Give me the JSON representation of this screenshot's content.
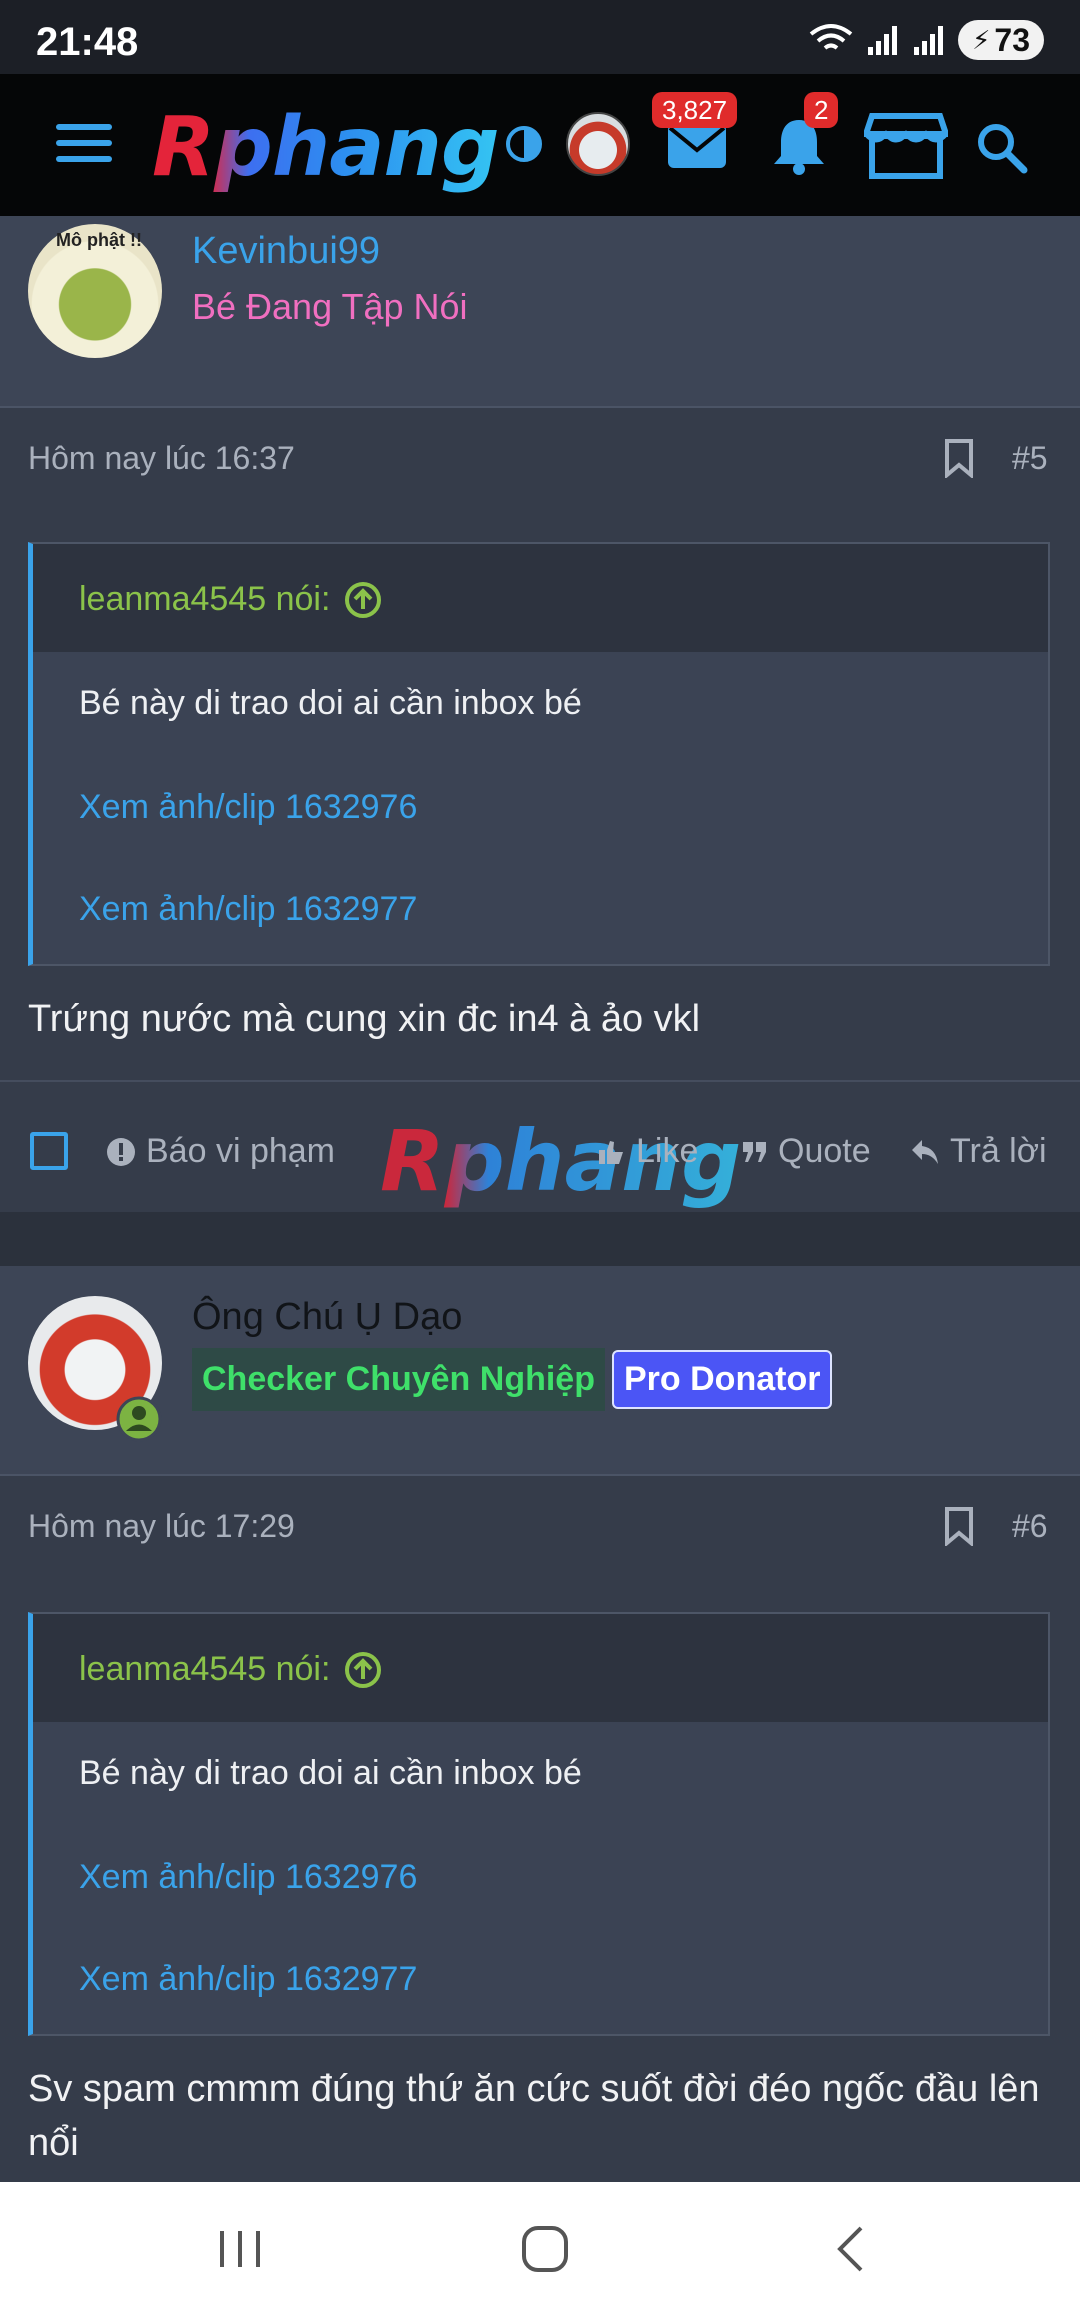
{
  "status_bar": {
    "time": "21:48",
    "battery": "73"
  },
  "header": {
    "logo": "Rphang",
    "messages_count": "3,827",
    "notifications_count": "2"
  },
  "posts": [
    {
      "username": "Kevinbui99",
      "user_title": "Bé Đang Tập Nói",
      "avatar_caption": "Mô phật !!",
      "timestamp": "Hôm nay lúc 16:37",
      "post_number": "#5",
      "quote": {
        "author": "leanma4545 nói:",
        "text": "Bé này di trao doi ai cần inbox bé",
        "links": [
          "Xem ảnh/clip 1632976",
          "Xem ảnh/clip 1632977"
        ]
      },
      "message": "Trứng nước mà cung xin đc in4 à ảo vkl",
      "actions": {
        "report": "Báo vi phạm",
        "like": "Like",
        "quote": "Quote",
        "reply": "Trả lời"
      },
      "watermark": "Rphang"
    },
    {
      "username": "Ông Chú Ụ Dạo",
      "badges": [
        "Checker Chuyên Nghiệp",
        "Pro Donator"
      ],
      "timestamp": "Hôm nay lúc 17:29",
      "post_number": "#6",
      "quote": {
        "author": "leanma4545 nói:",
        "text": "Bé này di trao doi ai cần inbox bé",
        "links": [
          "Xem ảnh/clip 1632976",
          "Xem ảnh/clip 1632977"
        ]
      },
      "message": "Sv spam cmmm đúng thứ ăn cức suốt đời đéo ngốc đầu lên nổi"
    }
  ],
  "colors": {
    "accent": "#3aa3ea",
    "quote_author": "#8bc34a",
    "user_title": "#f06fc0",
    "badge_checker": "#3fe06a",
    "badge_pro": "#4b55f5"
  },
  "icons": [
    "hamburger-icon",
    "contrast-icon",
    "mail-icon",
    "bell-icon",
    "store-icon",
    "search-icon",
    "bookmark-icon",
    "up-arrow-circle-icon",
    "report-icon",
    "like-icon",
    "quote-icon",
    "reply-icon",
    "online-user-icon"
  ]
}
